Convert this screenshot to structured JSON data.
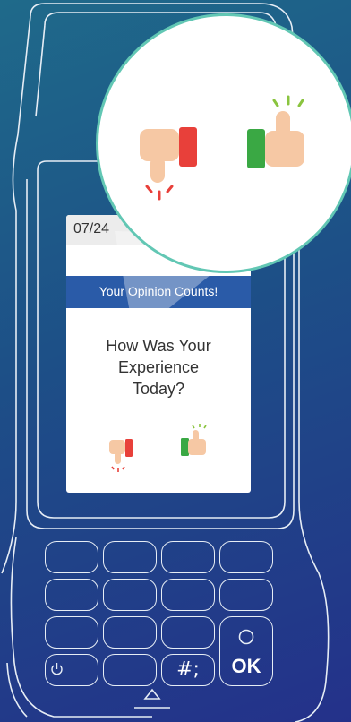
{
  "status_bar": {
    "date": "07/24"
  },
  "app": {
    "title": "Your Opinion Counts!",
    "question_lines": [
      "How Was Your",
      "Experience",
      "Today?"
    ]
  },
  "feedback": {
    "negative_icon": "thumbs-down-icon",
    "positive_icon": "thumbs-up-icon"
  },
  "keypad": {
    "hash_label": "#;",
    "ok_label": "OK",
    "power_icon": "power-icon",
    "circle_icon": "circle-icon"
  },
  "colors": {
    "background_start": "#1f6a8a",
    "background_end": "#24318a",
    "header_blue": "#2a5ba8",
    "thumb_red": "#e8403a",
    "thumb_green": "#3aa844",
    "skin": "#f6c8a4",
    "magnifier_ring": "#62c7b4"
  }
}
